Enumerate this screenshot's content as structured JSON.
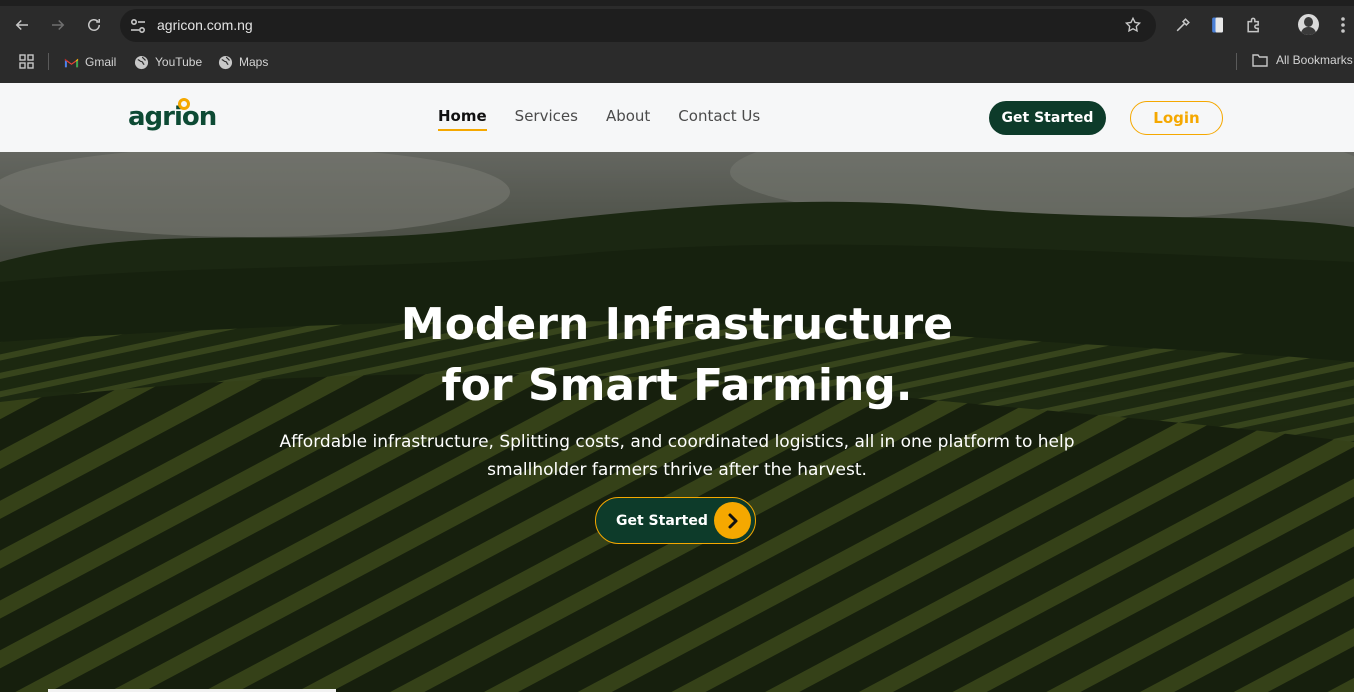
{
  "browser": {
    "url": "agricon.com.ng",
    "bookmarks": [
      {
        "label": "Gmail",
        "icon": "gmail-icon"
      },
      {
        "label": "YouTube",
        "icon": "globe-icon"
      },
      {
        "label": "Maps",
        "icon": "globe-icon"
      }
    ],
    "all_bookmarks_label": "All Bookmarks"
  },
  "site": {
    "logo_text": "agrion",
    "nav": [
      {
        "label": "Home",
        "active": true
      },
      {
        "label": "Services",
        "active": false
      },
      {
        "label": "About",
        "active": false
      },
      {
        "label": "Contact Us",
        "active": false
      }
    ],
    "get_started_label": "Get Started",
    "login_label": "Login",
    "colors": {
      "brand_green": "#0d3b2a",
      "accent_yellow": "#f5a800"
    }
  },
  "hero": {
    "title_line1": "Modern Infrastructure",
    "title_line2": "for Smart Farming.",
    "subtitle": "Affordable infrastructure, Splitting costs, and coordinated logistics, all in one platform to help smallholder farmers thrive after the harvest.",
    "cta_label": "Get Started",
    "cta_icon": "chevron-right-icon"
  }
}
